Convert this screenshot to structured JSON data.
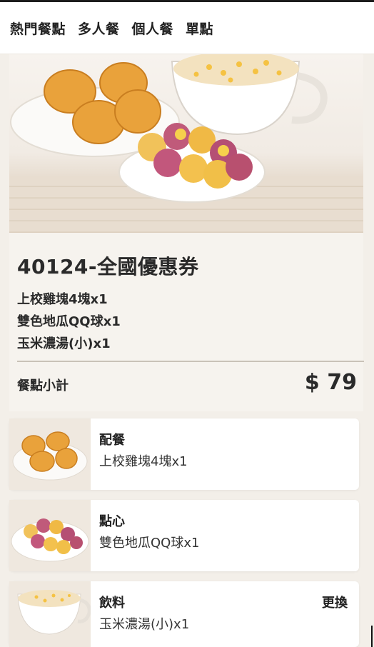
{
  "nav": {
    "tabs": [
      {
        "label": "熱門餐點"
      },
      {
        "label": "多人餐"
      },
      {
        "label": "個人餐"
      },
      {
        "label": "單點"
      }
    ]
  },
  "product": {
    "title": "40124-全國優惠券",
    "items": [
      "上校雞塊4塊x1",
      "雙色地瓜QQ球x1",
      "玉米濃湯(小)x1"
    ],
    "subtotal_label": "餐點小計",
    "subtotal_price": "$ 79"
  },
  "cards": [
    {
      "category": "配餐",
      "desc": "上校雞塊4塊x1",
      "icon": "nuggets-image"
    },
    {
      "category": "點心",
      "desc": "雙色地瓜QQ球x1",
      "icon": "sweet-potato-balls-image"
    },
    {
      "category": "飲料",
      "desc": "玉米濃湯(小)x1",
      "change_label": "更換",
      "icon": "corn-soup-image"
    }
  ]
}
